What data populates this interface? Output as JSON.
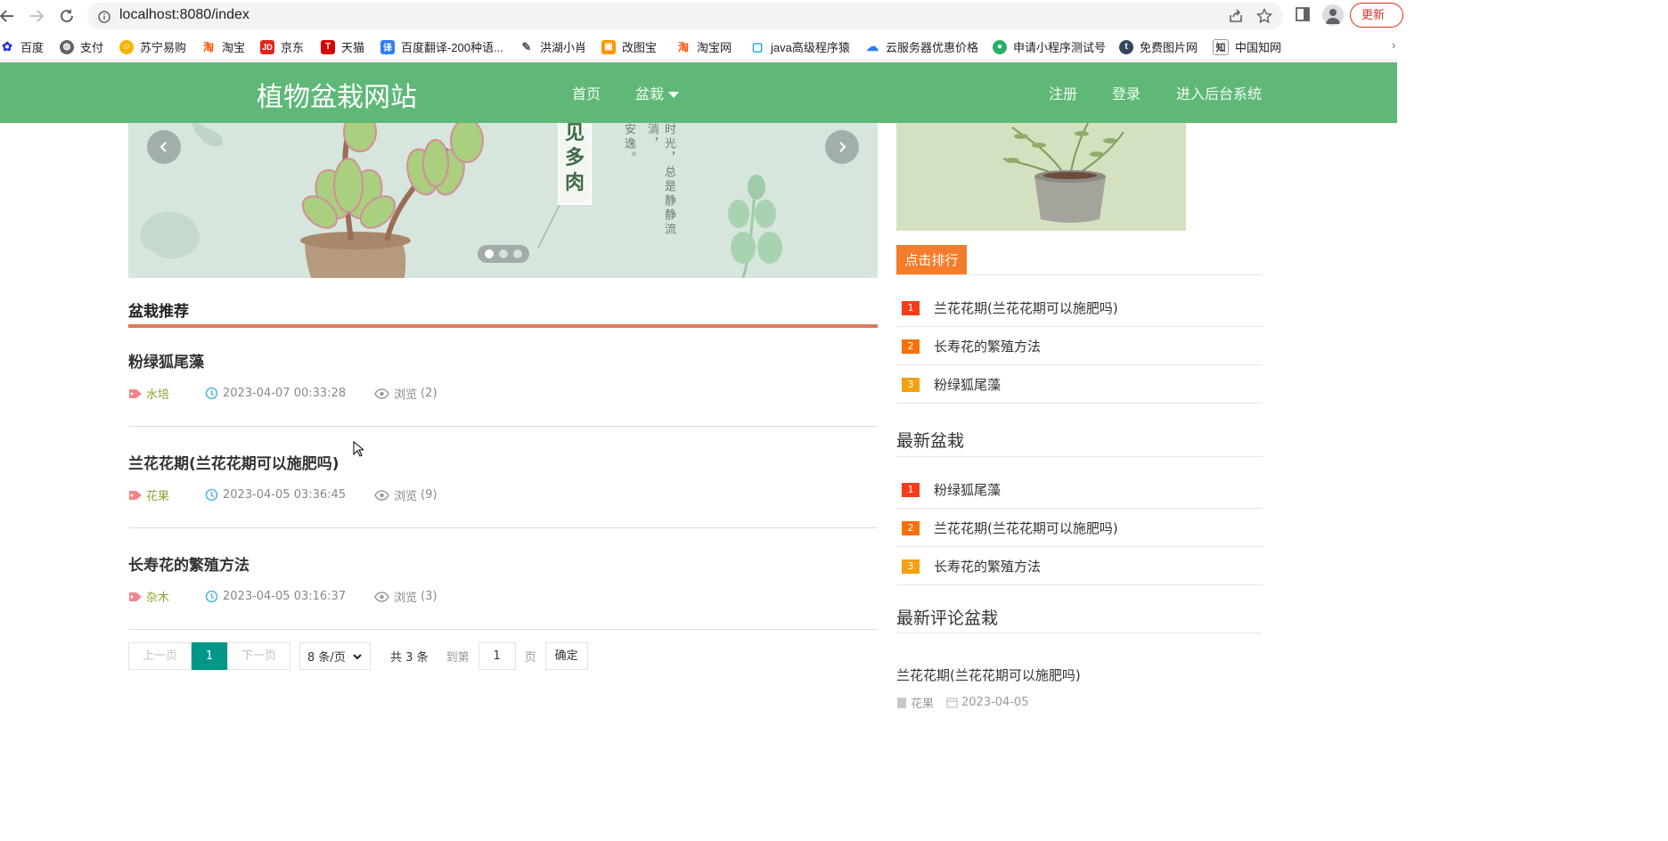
{
  "browser": {
    "url": "localhost:8080/index",
    "update_label": "更新",
    "bookmarks": [
      {
        "label": "百度",
        "icon": "baidu-icon"
      },
      {
        "label": "支付",
        "icon": "globe-icon"
      },
      {
        "label": "苏宁易购",
        "icon": "suning-icon"
      },
      {
        "label": "淘宝",
        "icon": "taobao-icon"
      },
      {
        "label": "京东",
        "icon": "jd-icon"
      },
      {
        "label": "天猫",
        "icon": "tmall-icon"
      },
      {
        "label": "百度翻译-200种语...",
        "icon": "translate-icon"
      },
      {
        "label": "洪湖小肖",
        "icon": "bookmark-icon"
      },
      {
        "label": "改图宝",
        "icon": "image-icon"
      },
      {
        "label": "淘宝网",
        "icon": "taobao-icon"
      },
      {
        "label": "java高级程序猿",
        "icon": "bilibili-icon"
      },
      {
        "label": "云服务器优惠价格",
        "icon": "cloud-icon"
      },
      {
        "label": "申请小程序测试号",
        "icon": "wechat-icon"
      },
      {
        "label": "免费图片网",
        "icon": "tumblr-icon"
      },
      {
        "label": "中国知网",
        "icon": "cnki-icon"
      }
    ]
  },
  "site": {
    "logo": "植物盆栽网站",
    "nav": {
      "home": "首页",
      "bonsai": "盆栽",
      "register": "注册",
      "login": "登录",
      "admin": "进入后台系统"
    }
  },
  "carousel": {
    "box_chars": [
      "见",
      "多",
      "肉"
    ],
    "vertical_text_1": "时光，总是静静流淌，",
    "vertical_text_2": "安逸。"
  },
  "main": {
    "section_title": "盆栽推荐",
    "view_label": "浏览",
    "articles": [
      {
        "title": "粉绿狐尾藻",
        "tag": "水培",
        "date": "2023-04-07 00:33:28",
        "views": "(2)"
      },
      {
        "title": "兰花花期(兰花花期可以施肥吗)",
        "tag": "花果",
        "date": "2023-04-05 03:36:45",
        "views": "(9)"
      },
      {
        "title": "长寿花的繁殖方法",
        "tag": "杂木",
        "date": "2023-04-05 03:16:37",
        "views": "(3)"
      }
    ],
    "pager": {
      "prev": "上一页",
      "current": "1",
      "next": "下一页",
      "page_size": "8 条/页",
      "total": "共 3 条",
      "goto": "到第",
      "goto_value": "1",
      "page_unit": "页",
      "confirm": "确定"
    }
  },
  "sidebar": {
    "rank_tab": "点击排行",
    "rank_items": [
      {
        "num": "1",
        "title": "兰花花期(兰花花期可以施肥吗)"
      },
      {
        "num": "2",
        "title": "长寿花的繁殖方法"
      },
      {
        "num": "3",
        "title": "粉绿狐尾藻"
      }
    ],
    "latest_title": "最新盆栽",
    "latest_items": [
      {
        "num": "1",
        "title": "粉绿狐尾藻"
      },
      {
        "num": "2",
        "title": "兰花花期(兰花花期可以施肥吗)"
      },
      {
        "num": "3",
        "title": "长寿花的繁殖方法"
      }
    ],
    "comment_title": "最新评论盆栽",
    "comment_item": {
      "title": "兰花花期(兰花花期可以施肥吗)",
      "tag": "花果",
      "date": "2023-04-05"
    }
  },
  "colors": {
    "header_green": "#5fb878",
    "rank_orange": "#f57c2b",
    "pager_teal": "#009688",
    "num_1": "#f53b1a",
    "num_2": "#f7700b",
    "num_3": "#f5a00e"
  }
}
